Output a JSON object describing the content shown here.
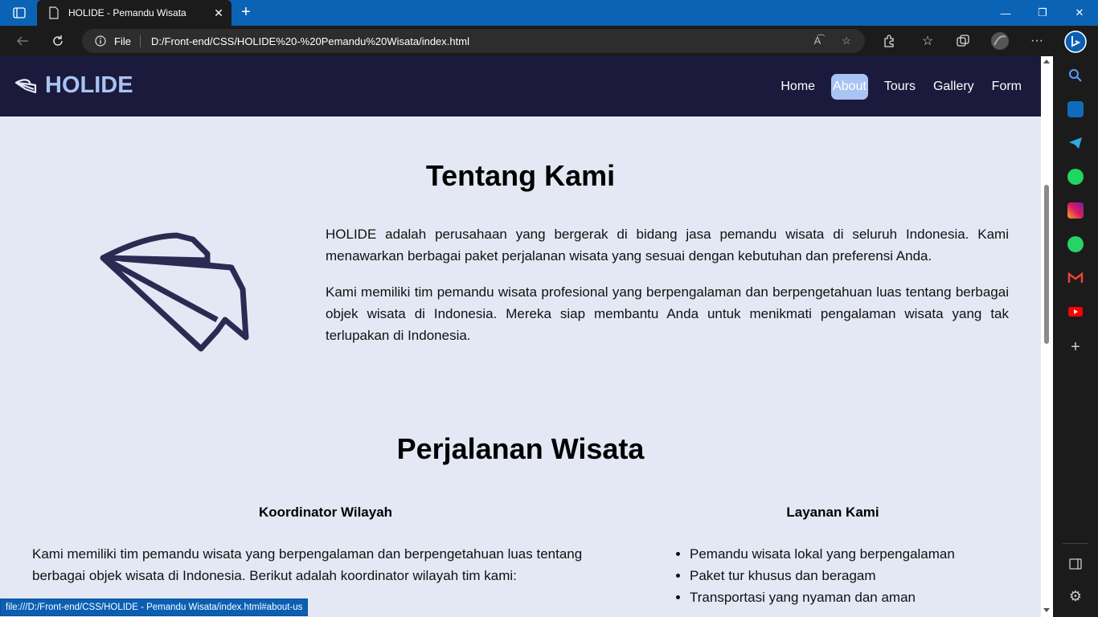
{
  "browser": {
    "tab_title": "HOLIDE - Pemandu Wisata",
    "address_label": "File",
    "url": "D:/Front-end/CSS/HOLIDE%20-%20Pemandu%20Wisata/index.html",
    "status_url": "file:///D:/Front-end/CSS/HOLIDE - Pemandu Wisata/index.html#about-us"
  },
  "nav": {
    "brand": "HOLIDE",
    "links": [
      "Home",
      "About",
      "Tours",
      "Gallery",
      "Form"
    ],
    "active": "About",
    "colors": {
      "bar": "#1b1a3c",
      "accent": "#a9c3f2"
    }
  },
  "about": {
    "title": "Tentang Kami",
    "paragraphs": [
      "HOLIDE adalah perusahaan yang bergerak di bidang jasa pemandu wisata di seluruh Indonesia. Kami menawarkan berbagai paket perjalanan wisata yang sesuai dengan kebutuhan dan preferensi Anda.",
      "Kami memiliki tim pemandu wisata profesional yang berpengalaman dan berpengetahuan luas tentang berbagai objek wisata di Indonesia. Mereka siap membantu Anda untuk menikmati pengalaman wisata yang tak terlupakan di Indonesia."
    ]
  },
  "tours": {
    "title": "Perjalanan Wisata",
    "coordinator": {
      "title": "Koordinator Wilayah",
      "text": "Kami memiliki tim pemandu wisata yang berpengalaman dan berpengetahuan luas tentang berbagai objek wisata di Indonesia. Berikut adalah koordinator wilayah tim kami:"
    },
    "services": {
      "title": "Layanan Kami",
      "items": [
        "Pemandu wisata lokal yang berpengalaman",
        "Paket tur khusus dan beragam",
        "Transportasi yang nyaman dan aman"
      ]
    }
  }
}
